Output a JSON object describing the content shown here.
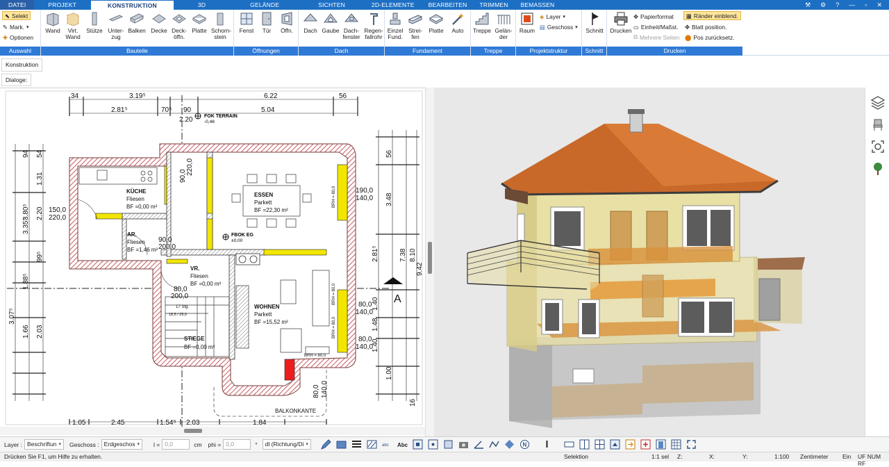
{
  "tabs": [
    {
      "label": "DATEI",
      "active": false
    },
    {
      "label": "PROJEKT",
      "active": false
    },
    {
      "label": "KONSTRUKTION",
      "active": true
    },
    {
      "label": "3D",
      "active": false
    },
    {
      "label": "GELÄNDE",
      "active": false
    },
    {
      "label": "SICHTEN",
      "active": false
    },
    {
      "label": "2D-ELEMENTE",
      "active": false
    },
    {
      "label": "BEARBEITEN",
      "active": false
    },
    {
      "label": "TRIMMEN",
      "active": false
    },
    {
      "label": "BEMASSEN",
      "active": false
    }
  ],
  "ribbon": {
    "auswahl": {
      "select": "Selekt",
      "mark": "Mark.",
      "options": "Optionen",
      "group": "Auswahl"
    },
    "bauteile": {
      "wand": "Wand",
      "virt_wand": "Virt.\nWand",
      "stuetze": "Stütze",
      "unterzug": "Unter-\nzug",
      "balken": "Balken",
      "decke": "Decke",
      "deckoeffn": "Deck-\nöffn.",
      "platte": "Platte",
      "schornstein": "Schorn-\nstein",
      "group": "Bauteile"
    },
    "oeffnungen": {
      "fenst": "Fenst",
      "tuer": "Tür",
      "oeffn": "Öffn.",
      "group": "Öffnungen"
    },
    "dach": {
      "dach": "Dach",
      "gaube": "Gaube",
      "dachfenster": "Dach-\nfenster",
      "regenfallrohr": "Regen-\nfallrohr",
      "group": "Dach"
    },
    "fundament": {
      "einzel": "Einzel\nFund.",
      "streifen": "Strei-\nfen",
      "platte": "Platte",
      "auto": "Auto",
      "group": "Fundament"
    },
    "treppe": {
      "treppe": "Treppe",
      "gelaender": "Gelän-\nder",
      "group": "Treppe"
    },
    "projektstruktur": {
      "raum": "Raum",
      "layer": "Layer",
      "geschoss": "Geschoss",
      "group": "Projektstruktur"
    },
    "schnitt": {
      "schnitt": "Schnitt",
      "group": "Schnitt"
    },
    "drucken": {
      "drucken": "Drucken",
      "papierformat": "Papierformat",
      "einheit": "Einheit/Maßst.",
      "mehrere": "Mehrere Seiten",
      "raender": "Ränder einblend.",
      "blatt": "Blatt position.",
      "pos": "Pos zurücksetz.",
      "group": "Drucken"
    }
  },
  "subbar": {
    "konstruktion": "Konstruktion",
    "dialoge": "Dialoge:"
  },
  "plan": {
    "rooms": [
      {
        "name": "KÜCHE",
        "floor": "Fliesen",
        "area": "BF =0,00 m²"
      },
      {
        "name": "AR.",
        "floor": "Fliesen",
        "area": "BF =1,46 m²"
      },
      {
        "name": "ESSEN",
        "floor": "Parkett",
        "area": "BF =22,30 m²"
      },
      {
        "name": "VR.",
        "floor": "Fliesen",
        "area": "BF =0,00 m²"
      },
      {
        "name": "WOHNEN",
        "floor": "Parkett",
        "area": "BF =15,52 m²"
      },
      {
        "name": "STIEGE",
        "floor": "",
        "area": "BF =0,00 m²"
      }
    ],
    "labels": {
      "fok_terrain": "FOK TERRAIN",
      "fok_terrain_val": "-0,48",
      "fbok_eg": "FBOK EG",
      "fbok_eg_val": "±0,00",
      "balkonkante": "BALKONKANTE",
      "section": "A",
      "stair_steps": "17 Stg.",
      "stair_dim": "18,5 / 25,0",
      "brh1": "BRH = 80,0",
      "brh2": "BRH = 80,0",
      "brh3": "BRH = 80,0",
      "brh4": "BRH = 80,0"
    },
    "dims_top": [
      "2.81⁵",
      "70⁵",
      "90",
      "5.04",
      "3.19⁵",
      "6.22",
      "56",
      "34"
    ],
    "dims_top2": [
      "2.20",
      "220,0",
      "90,0"
    ],
    "dims_bottom": [
      "2.45",
      "2.03",
      "1.84",
      "1.54⁵",
      "1.05"
    ],
    "dims_left": [
      "3.80⁵",
      "3.35⁵",
      "1.31",
      "2.20",
      "1.88⁵",
      "3.07⁵",
      "1.66",
      "2.03",
      "54",
      "99⁵",
      "94"
    ],
    "dims_right": [
      "3.48",
      "2.81⁵",
      "7.38",
      "8.10",
      "9.42",
      "1.40",
      "1.48",
      "1.40",
      "56",
      "1.00",
      "16"
    ],
    "opening_dims": [
      "150,0",
      "220,0",
      "90,0",
      "200,0",
      "80,0",
      "200,0",
      "190,0",
      "140,0",
      "80,0",
      "140,0",
      "80,0",
      "140,0",
      "80,0",
      "140,0"
    ]
  },
  "bottom": {
    "layer_label": "Layer :",
    "layer_value": "Beschriftun",
    "geschoss_label": "Geschoss :",
    "geschoss_value": "Erdgeschos",
    "l_label": "l =",
    "l_value": "0,0",
    "l_unit": "cm",
    "phi_label": "phi =",
    "phi_value": "0,0",
    "phi_unit": "°",
    "dir_value": "dl (Richtung/Di"
  },
  "status": {
    "help": "Drücken Sie F1, um Hilfe zu erhalten.",
    "mode": "Selektion",
    "scale": "1:1 sel",
    "x": "X:",
    "y": "Y:",
    "z": "Z:",
    "ratio": "1:100",
    "unit": "Zentimeter",
    "ein": "Ein",
    "flags": "UF NUM RF"
  },
  "colors": {
    "accent": "#1d6fc4",
    "ribbon_group": "#2f7ad6",
    "wall_hatch": "#c9686b",
    "window_yellow": "#f2e600",
    "roof": "#c8692a",
    "facade": "#e9e0a6"
  }
}
